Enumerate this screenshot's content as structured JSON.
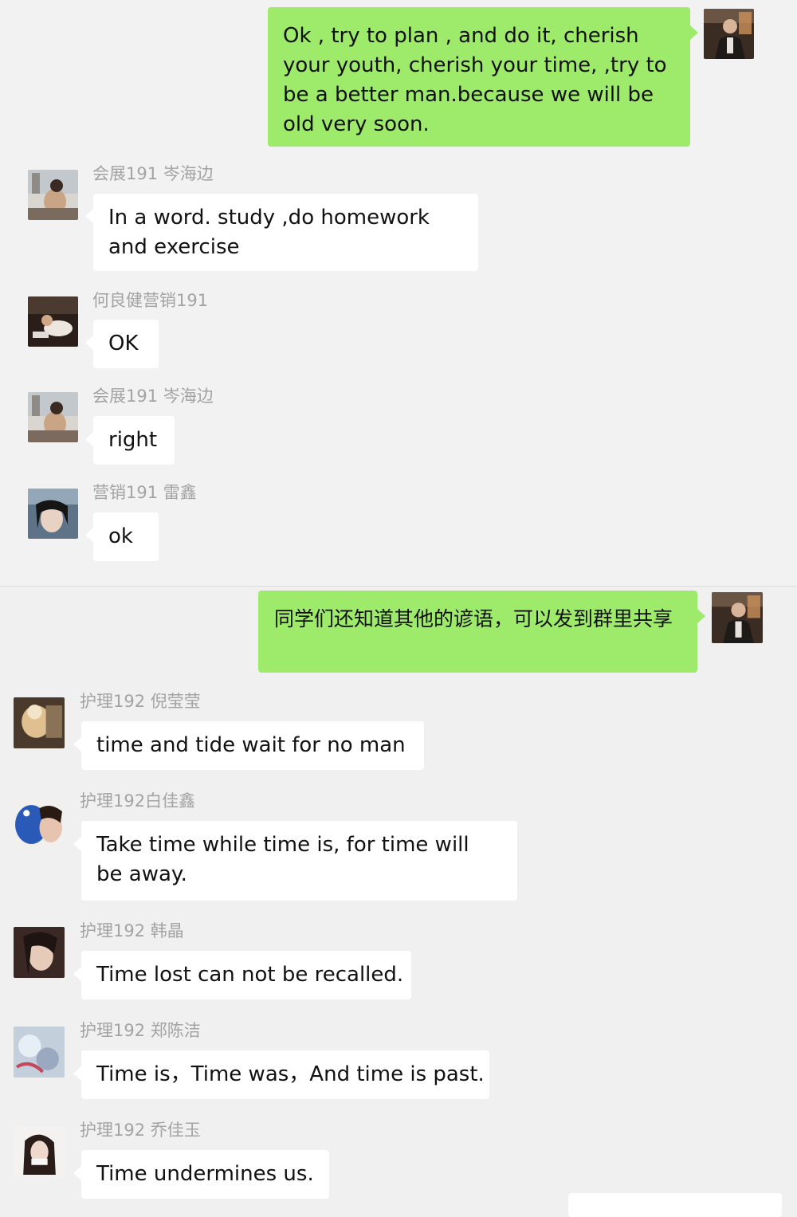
{
  "section1": {
    "outgoing": {
      "text": "Ok , try to plan , and do it, cherish your youth, cherish your time, ,try to be a better man.because we will be old very soon."
    },
    "messages": [
      {
        "name": "会展191 岑海边",
        "text": "In a word. study ,do homework and exercise"
      },
      {
        "name": "何良健营销191",
        "text": "OK"
      },
      {
        "name": "会展191 岑海边",
        "text": "right"
      },
      {
        "name": "营销191  雷鑫",
        "text": "ok"
      }
    ]
  },
  "section2": {
    "outgoing": {
      "text": "同学们还知道其他的谚语，可以发到群里共享"
    },
    "messages": [
      {
        "name": "护理192 倪莹莹",
        "text": "time and  tide wait for no man"
      },
      {
        "name": "护理192白佳鑫",
        "text": "Take time while time is, for time will be away."
      },
      {
        "name": "护理192  韩晶",
        "text": "Time lost can not be recalled."
      },
      {
        "name": "护理192   郑陈洁",
        "text": "Time is，Time was，And time is past."
      },
      {
        "name": "护理192  乔佳玉",
        "text": "Time undermines us."
      }
    ]
  },
  "colors": {
    "outgoing_bubble": "#9eea6a",
    "incoming_bubble": "#ffffff",
    "background": "#f2f2f2",
    "sender_name": "#a3a3a3"
  }
}
